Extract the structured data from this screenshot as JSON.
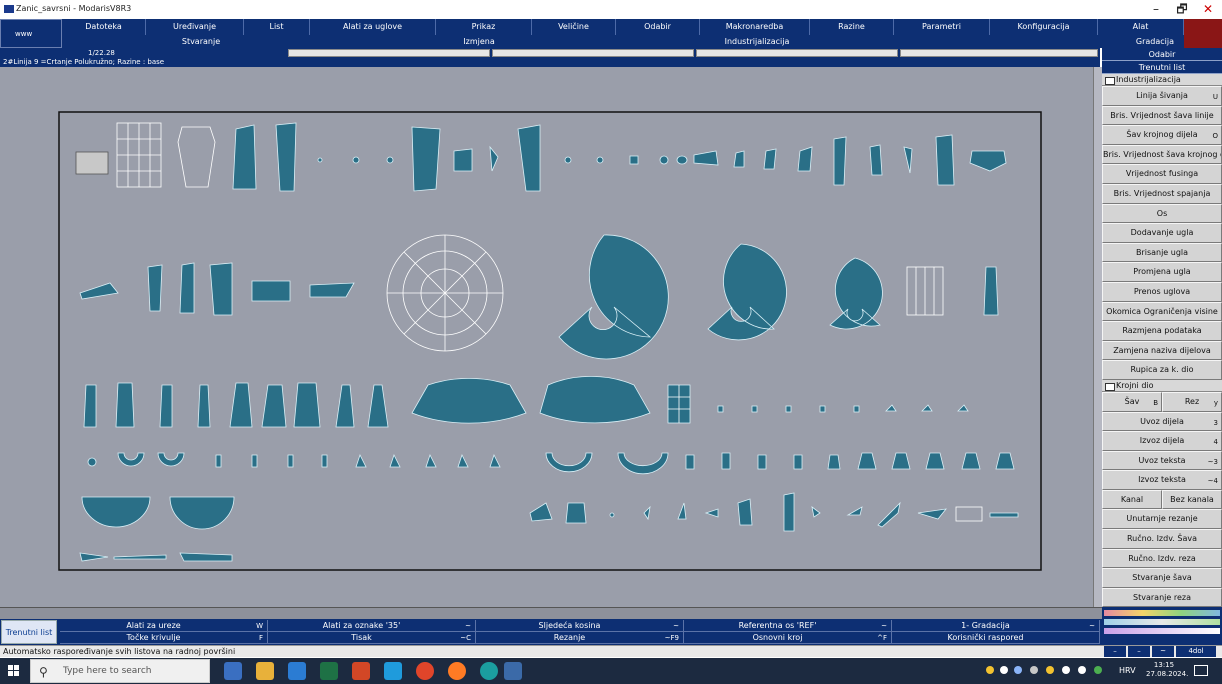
{
  "window": {
    "title": "Zanic_savrsni - ModarisV8R3",
    "min_glyph": "–",
    "max_glyph": "🗗",
    "close_glyph": "✕"
  },
  "logo_label": "www",
  "menus_row1": [
    "Datoteka",
    "Uređivanje",
    "List",
    "Alati za uglove",
    "Prikaz",
    "Veličine",
    "Odabir",
    "Makronaredba",
    "Razine",
    "Parametri",
    "Konfiguracija",
    "Alat"
  ],
  "menus_row2": [
    "Stvaranje",
    "Izmjena",
    "Industrijalizacija",
    "Gradacija"
  ],
  "info": {
    "ratio": "1/22.28",
    "status": "2#Linija 9 =Crtanje  Polukružno;  Razine :  base"
  },
  "right_panel": {
    "header_odabir": "Odabir",
    "header_trenutni": "Trenutni list",
    "section_industrijalizacija": "Industrijalizacija",
    "industrijalizacija_buttons": [
      {
        "label": "Linija šivanja",
        "key": "U"
      },
      {
        "label": "Bris. Vrijednost šava linije",
        "key": ""
      },
      {
        "label": "Šav krojnog dijela",
        "key": "O"
      },
      {
        "label": "Bris. Vrijednost šava krojnog d",
        "key": ""
      },
      {
        "label": "Vrijednost fusinga",
        "key": ""
      },
      {
        "label": "Bris. Vrijednost spajanja",
        "key": ""
      },
      {
        "label": "Os",
        "key": ""
      },
      {
        "label": "Dodavanje ugla",
        "key": ""
      },
      {
        "label": "Brisanje ugla",
        "key": ""
      },
      {
        "label": "Promjena ugla",
        "key": ""
      },
      {
        "label": "Prenos uglova",
        "key": ""
      },
      {
        "label": "Okomica Ograničenja visine",
        "key": ""
      },
      {
        "label": "Razmjena podataka",
        "key": ""
      },
      {
        "label": "Zamjena naziva dijelova",
        "key": ""
      },
      {
        "label": "Rupica za k. dio",
        "key": ""
      }
    ],
    "section_krojni": "Krojni dio",
    "sav_label": "Šav",
    "sav_key": "B",
    "rez_label": "Rez",
    "rez_key": "y",
    "krojni_buttons": [
      {
        "label": "Uvoz dijela",
        "key": "3"
      },
      {
        "label": "Izvoz dijela",
        "key": "4"
      },
      {
        "label": "Uvoz teksta",
        "key": "~3"
      },
      {
        "label": "Izvoz teksta",
        "key": "~4"
      }
    ],
    "kanal_label": "Kanal",
    "bez_kanala_label": "Bez kanala",
    "krojni_buttons2": [
      {
        "label": "Unutarnje rezanje",
        "key": ""
      },
      {
        "label": "Ručno. Izdv. Šava",
        "key": ""
      },
      {
        "label": "Ručno. Izdv. reza",
        "key": ""
      },
      {
        "label": "Stvaranje šava",
        "key": ""
      },
      {
        "label": "Stvaranje reza",
        "key": ""
      }
    ]
  },
  "bottom": {
    "current_sheet": "Trenutni list",
    "row1": [
      {
        "label": "Alati za ureze",
        "key": "W"
      },
      {
        "label": "Alati za oznake '35'",
        "key": "~"
      },
      {
        "label": "Sljedeća kosina",
        "key": "~"
      },
      {
        "label": "Referentna os 'REF'",
        "key": "~"
      },
      {
        "label": "1- Gradacija",
        "key": "~"
      }
    ],
    "row2": [
      {
        "label": "Točke krivulje",
        "key": "F"
      },
      {
        "label": "Tisak",
        "key": "~C"
      },
      {
        "label": "Rezanje",
        "key": "~F9"
      },
      {
        "label": "Osnovni kroj",
        "key": "^F"
      },
      {
        "label": "Korisnički raspored",
        "key": ""
      }
    ],
    "status_message": "Automatsko raspoređivanje svih listova na radnoj površini",
    "mini_buttons": [
      "–",
      "–",
      "~",
      "4dol"
    ]
  },
  "taskbar": {
    "search_placeholder": "Type here to search",
    "language": "HRV",
    "time": "13:15",
    "date": "27.08.2024."
  },
  "colors": {
    "menu_blue": "#0d2f73",
    "canvas_gray": "#9a9eaa",
    "piece_teal": "#2a6f87"
  }
}
